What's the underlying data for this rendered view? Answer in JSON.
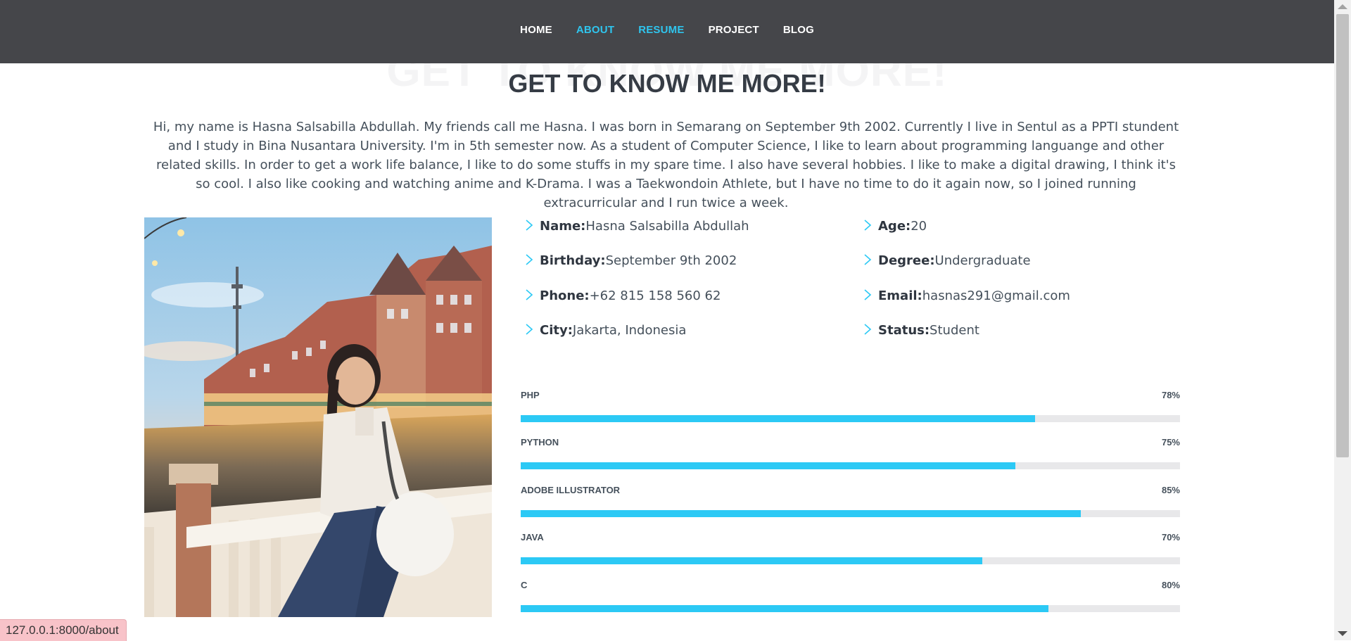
{
  "nav": {
    "items": [
      {
        "label": "HOME",
        "active": false
      },
      {
        "label": "ABOUT",
        "active": true
      },
      {
        "label": "RESUME",
        "active": true
      },
      {
        "label": "PROJECT",
        "active": false
      },
      {
        "label": "BLOG",
        "active": false
      }
    ]
  },
  "section": {
    "title_bg": "GET TO KNOW ME MORE!",
    "title": "GET TO KNOW ME MORE!",
    "intro": "Hi, my name is Hasna Salsabilla Abdullah. My friends call me Hasna. I was born in Semarang on September 9th 2002. Currently I live in Sentul as a PPTI stundent and I study in Bina Nusantara University. I'm in 5th semester now. As a student of Computer Science, I like to learn about programming languange and other related skills. In order to get a work life balance, I like to do some stuffs in my spare time. I also have several hobbies. I like to make a digital drawing, I think it's so cool. I also like cooking and watching anime and K-Drama. I was a Taekwondoin Athlete, but I have no time to do it again now, so I joined running extracurricular and I run twice a week."
  },
  "info": {
    "left": [
      {
        "label": "Name:",
        "value": "Hasna Salsabilla Abdullah"
      },
      {
        "label": "Birthday:",
        "value": "September 9th 2002"
      },
      {
        "label": "Phone:",
        "value": "+62 815 158 560 62"
      },
      {
        "label": "City:",
        "value": "Jakarta, Indonesia"
      }
    ],
    "right": [
      {
        "label": "Age:",
        "value": "20"
      },
      {
        "label": "Degree:",
        "value": "Undergraduate"
      },
      {
        "label": "Email:",
        "value": "hasnas291@gmail.com"
      },
      {
        "label": "Status:",
        "value": "Student"
      }
    ]
  },
  "skills": [
    {
      "name": "PHP",
      "value_label": "78%",
      "percent": 78
    },
    {
      "name": "PYTHON",
      "value_label": "75%",
      "percent": 75
    },
    {
      "name": "ADOBE ILLUSTRATOR",
      "value_label": "85%",
      "percent": 85
    },
    {
      "name": "JAVA",
      "value_label": "70%",
      "percent": 70
    },
    {
      "name": "C",
      "value_label": "80%",
      "percent": 80
    }
  ],
  "status_bar": {
    "url": "127.0.0.1:8000/about"
  },
  "colors": {
    "accent": "#2fc5ee",
    "nav_bg": "#45464a",
    "bar_fill": "#2cc9f5",
    "bar_track": "#e8e8ea"
  },
  "icons": {
    "info_bullet": "chevron-right-icon"
  }
}
